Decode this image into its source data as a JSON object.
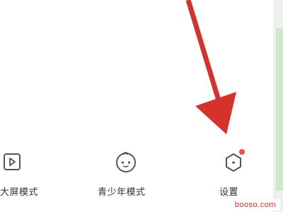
{
  "menu": {
    "items": [
      {
        "label": "大屏模式",
        "icon": "play-screen-icon"
      },
      {
        "label": "青少年模式",
        "icon": "child-face-icon"
      },
      {
        "label": "设置",
        "icon": "hexagon-settings-icon",
        "badge": true
      }
    ]
  },
  "watermark": {
    "text": "booso.com"
  },
  "colors": {
    "arrow": "#d6322c",
    "badge": "#f04a4a",
    "icon_stroke": "#555555",
    "label": "#333333"
  }
}
